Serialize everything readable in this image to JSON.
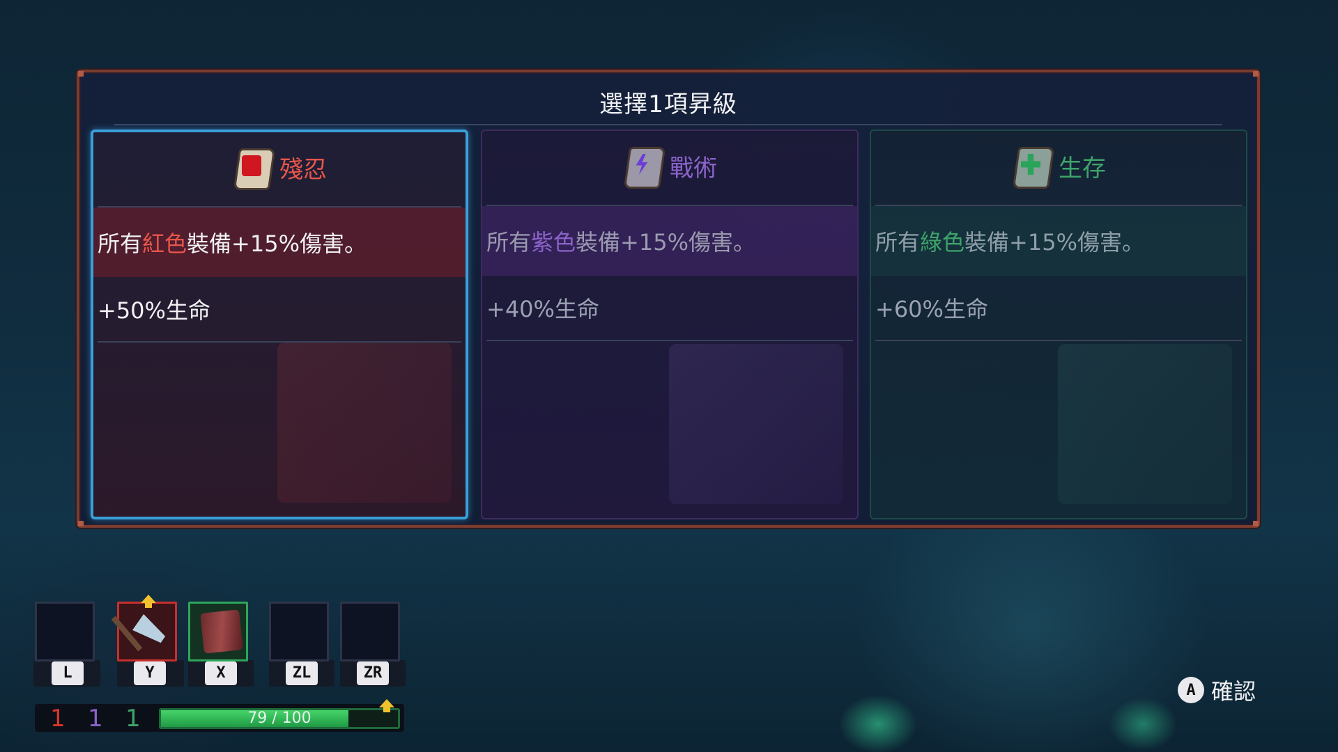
{
  "dialog": {
    "title": "選擇1項昇級"
  },
  "cards": [
    {
      "name": "殘忍",
      "icon": "brutality-scroll-icon",
      "color": "#e8564a",
      "effect_prefix": "所有",
      "effect_color_word": "紅色",
      "effect_suffix": "裝備+15%傷害。",
      "life_bonus": "+50%生命",
      "selected": true
    },
    {
      "name": "戰術",
      "icon": "tactics-scroll-icon",
      "color": "#8a63c8",
      "effect_prefix": "所有",
      "effect_color_word": "紫色",
      "effect_suffix": "裝備+15%傷害。",
      "life_bonus": "+40%生命",
      "selected": false
    },
    {
      "name": "生存",
      "icon": "survival-scroll-icon",
      "color": "#3ea46a",
      "effect_prefix": "所有",
      "effect_color_word": "綠色",
      "effect_suffix": "裝備+15%傷害。",
      "life_bonus": "+60%生命",
      "selected": false
    }
  ],
  "hud": {
    "slots": [
      {
        "key": "L",
        "item": "empty",
        "highlight": "none"
      },
      {
        "key": "Y",
        "item": "axe-icon",
        "highlight": "#c6302c",
        "upgrade_available": true
      },
      {
        "key": "X",
        "item": "crate-shield-icon",
        "highlight": "#2fa45c"
      },
      {
        "key": "ZL",
        "item": "empty",
        "highlight": "none"
      },
      {
        "key": "ZR",
        "item": "empty",
        "highlight": "none"
      }
    ],
    "counts": {
      "red": "1",
      "purple": "1",
      "green": "1",
      "red_color": "#d7372c",
      "purple_color": "#8a63c8",
      "green_color": "#3ea46a"
    },
    "xp": {
      "current": "79",
      "separator": "/",
      "max": "100",
      "fraction": 0.79,
      "text": "79 / 100"
    }
  },
  "confirm": {
    "button": "A",
    "label": "確認"
  }
}
